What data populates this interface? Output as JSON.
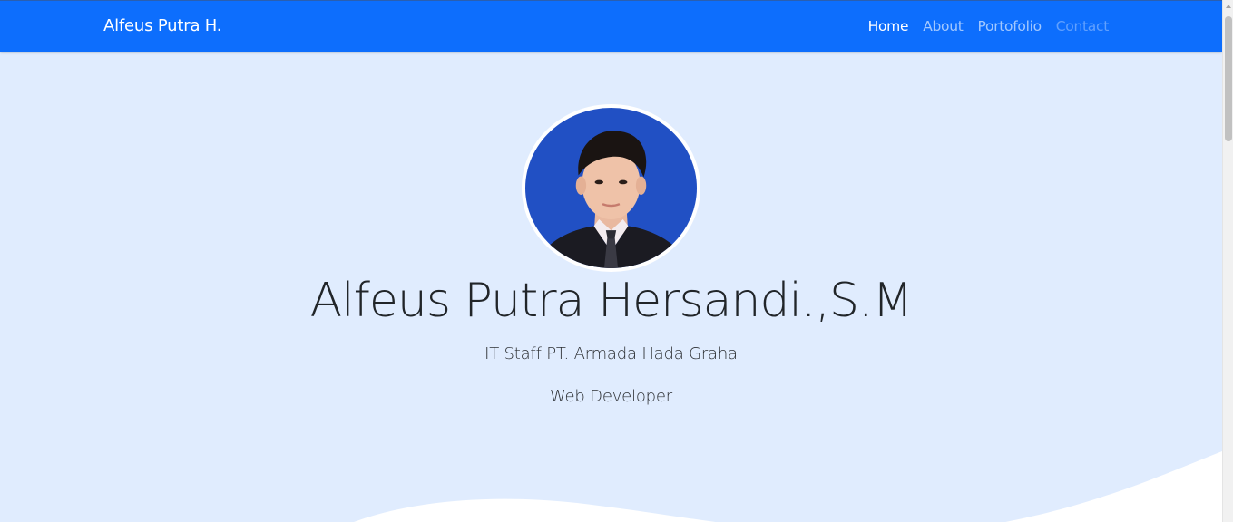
{
  "navbar": {
    "brand": "Alfeus Putra H.",
    "links": [
      {
        "label": "Home",
        "state": "active"
      },
      {
        "label": "About",
        "state": "inactive"
      },
      {
        "label": "Portofolio",
        "state": "inactive"
      },
      {
        "label": "Contact",
        "state": "dim"
      }
    ]
  },
  "hero": {
    "name": "Alfeus Putra Hersandi.,S.M",
    "role": "IT Staff PT. Armada Hada Graha",
    "title": "Web Developer"
  },
  "colors": {
    "navbar_bg": "#0d6efd",
    "page_bg": "#e0ecfe",
    "photo_bg": "#2150c4"
  },
  "icons": {
    "avatar": "profile-photo"
  }
}
